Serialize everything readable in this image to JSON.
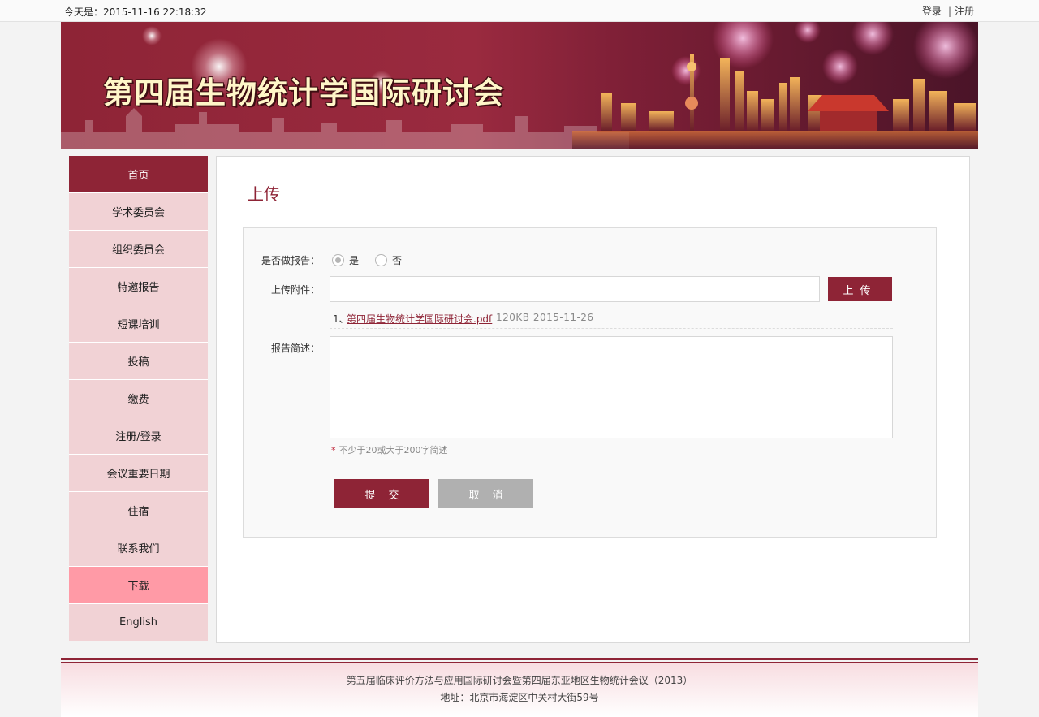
{
  "topbar": {
    "date": "今天是：2015-11-16 22:18:32",
    "login": "登录",
    "separator": "|",
    "register": "注册"
  },
  "banner": {
    "title": "第四届生物统计学国际研讨会"
  },
  "nav": {
    "items": [
      {
        "label": "首页"
      },
      {
        "label": "学术委员会"
      },
      {
        "label": "组织委员会"
      },
      {
        "label": "特邀报告"
      },
      {
        "label": "短课培训"
      },
      {
        "label": "投稿"
      },
      {
        "label": "缴费"
      },
      {
        "label": "注册/登录"
      },
      {
        "label": "会议重要日期"
      },
      {
        "label": "住宿"
      },
      {
        "label": "联系我们"
      },
      {
        "label": "下载"
      },
      {
        "label": "English"
      }
    ]
  },
  "page": {
    "title": "上传"
  },
  "form": {
    "report_label": "是否做报告：",
    "option_yes": "是",
    "option_no": "否",
    "attachment_label": "上传附件：",
    "upload_button": "上传",
    "file_index": "1、",
    "file_name": "第四届生物统计学国际研讨会.pdf",
    "file_meta": "120KB  2015-11-26",
    "summary_label": "报告简述：",
    "hint_star": "*",
    "hint": "不少于20或大于200字简述",
    "submit_button": "提交",
    "cancel_button": "取消"
  },
  "footer": {
    "line1": "第五届临床评价方法与应用国际研讨会暨第四届东亚地区生物统计会议（2013）",
    "line2": "地址：北京市海淀区中关村大街59号"
  },
  "colors": {
    "brand": "#8e2436",
    "nav_bg": "#f1d2d5",
    "nav_current": "#ff9aa6",
    "cancel": "#b0b0b0"
  }
}
